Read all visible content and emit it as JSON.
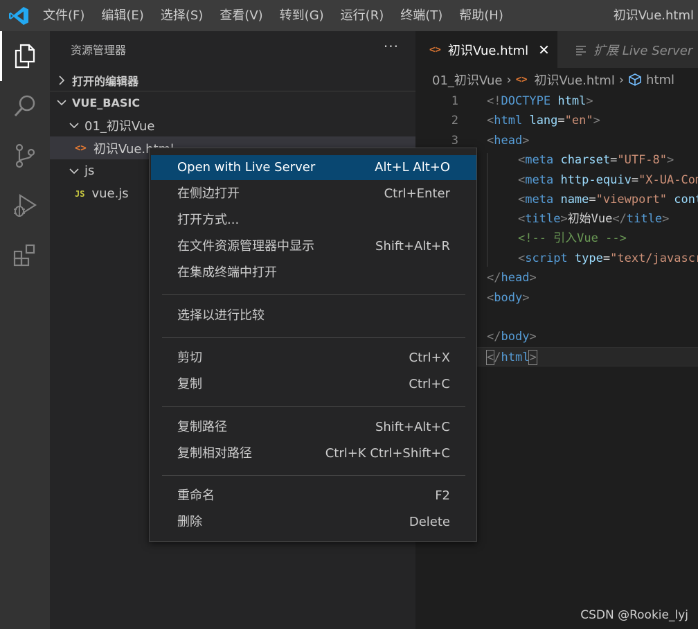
{
  "menubar": {
    "items": [
      "文件(F)",
      "编辑(E)",
      "选择(S)",
      "查看(V)",
      "转到(G)",
      "运行(R)",
      "终端(T)",
      "帮助(H)"
    ],
    "window_title": "初识Vue.html"
  },
  "activitybar": {
    "items": [
      "explorer-icon",
      "search-icon",
      "source-control-icon",
      "run-debug-icon",
      "extensions-icon"
    ]
  },
  "sidebar": {
    "title": "资源管理器",
    "more": "···",
    "open_editors": "打开的编辑器",
    "workspace": "VUE_BASIC",
    "folder_1": "01_初识Vue",
    "file_1": "初识Vue.html",
    "folder_2": "js",
    "file_2": "vue.js",
    "html_icon": "<>",
    "js_icon": "JS"
  },
  "editor": {
    "tabs": [
      {
        "label": "初识Vue.html",
        "active": true
      },
      {
        "label": "扩展 Live Server",
        "active": false
      }
    ],
    "close": "✕",
    "breadcrumb": [
      "01_初识Vue",
      "初识Vue.html",
      "html"
    ],
    "line_numbers": [
      "1",
      "2",
      "3"
    ]
  },
  "context_menu": {
    "items": [
      {
        "label": "Open with Live Server",
        "key": "Alt+L Alt+O"
      },
      {
        "label": "在侧边打开",
        "key": "Ctrl+Enter"
      },
      {
        "label": "打开方式...",
        "key": ""
      },
      {
        "label": "在文件资源管理器中显示",
        "key": "Shift+Alt+R"
      },
      {
        "label": "在集成终端中打开",
        "key": ""
      },
      {
        "label": "选择以进行比较",
        "key": ""
      },
      {
        "label": "剪切",
        "key": "Ctrl+X"
      },
      {
        "label": "复制",
        "key": "Ctrl+C"
      },
      {
        "label": "复制路径",
        "key": "Shift+Alt+C"
      },
      {
        "label": "复制相对路径",
        "key": "Ctrl+K Ctrl+Shift+C"
      },
      {
        "label": "重命名",
        "key": "F2"
      },
      {
        "label": "删除",
        "key": "Delete"
      }
    ]
  },
  "watermark": "CSDN @Rookie_lyj",
  "colors": {
    "accent": "#094771",
    "tag": "#569cd6",
    "attribute": "#9cdcfe",
    "string": "#ce9178",
    "comment": "#6a9955"
  }
}
